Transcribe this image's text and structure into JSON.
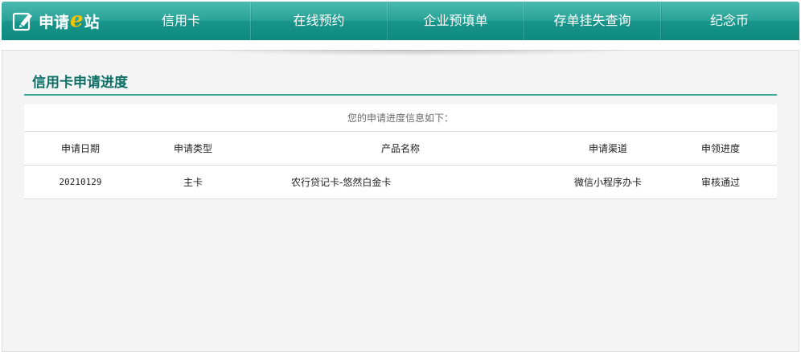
{
  "header": {
    "logo_text_before": "申请",
    "logo_text_e": "e",
    "logo_text_after": "站",
    "nav": [
      {
        "label": "信用卡"
      },
      {
        "label": "在线预约"
      },
      {
        "label": "企业预填单"
      },
      {
        "label": "存单挂失查询"
      },
      {
        "label": "纪念币"
      }
    ]
  },
  "page": {
    "title": "信用卡申请进度"
  },
  "table": {
    "caption": "您的申请进度信息如下：",
    "columns": [
      "申请日期",
      "申请类型",
      "产品名称",
      "申请渠道",
      "申领进度"
    ],
    "rows": [
      {
        "date": "20210129",
        "type": "主卡",
        "product": "农行贷记卡-悠然白金卡",
        "channel": "微信小程序办卡",
        "status": "审核通过"
      }
    ]
  },
  "colors": {
    "brand": "#1a9a8e",
    "accent_logo": "#f3c200",
    "title": "#0d6f66"
  }
}
